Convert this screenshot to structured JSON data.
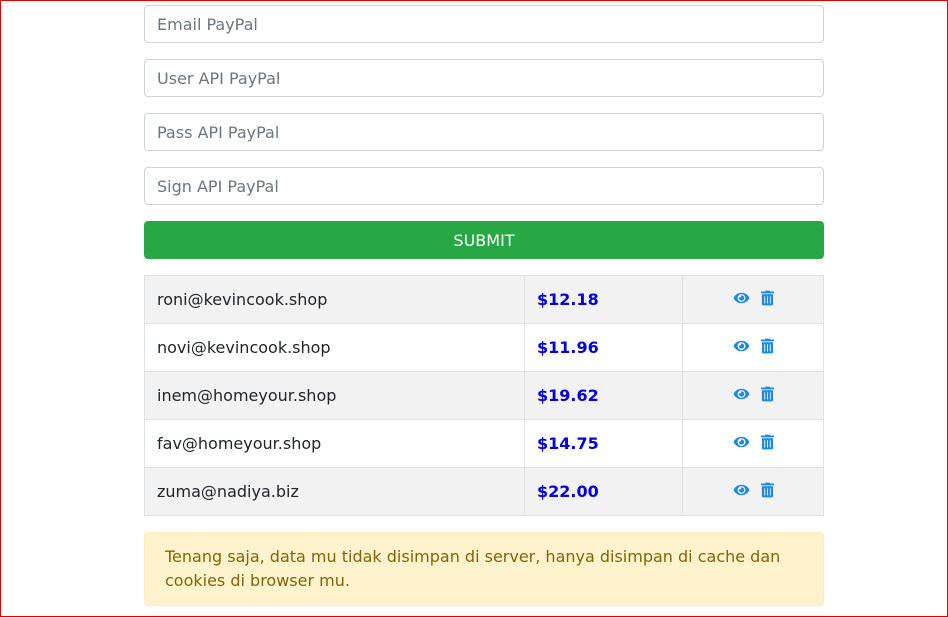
{
  "form": {
    "email_placeholder": "Email PayPal",
    "user_api_placeholder": "User API PayPal",
    "pass_api_placeholder": "Pass API PayPal",
    "sign_api_placeholder": "Sign API PayPal",
    "submit_label": "SUBMIT"
  },
  "accounts": [
    {
      "email": "roni@kevincook.shop",
      "amount": "$12.18"
    },
    {
      "email": "novi@kevincook.shop",
      "amount": "$11.96"
    },
    {
      "email": "inem@homeyour.shop",
      "amount": "$19.62"
    },
    {
      "email": "fav@homeyour.shop",
      "amount": "$14.75"
    },
    {
      "email": "zuma@nadiya.biz",
      "amount": "$22.00"
    }
  ],
  "icons": {
    "view": "eye-icon",
    "delete": "trash-icon"
  },
  "notice": {
    "text": "Tenang saja, data mu tidak disimpan di server, hanya disimpan di cache dan cookies di browser mu."
  },
  "colors": {
    "submit": "#28a745",
    "amount": "#0000e0",
    "icon": "#1e88e5",
    "notice_bg": "#fff3cd",
    "notice_text": "#856404",
    "frame": "#e00000"
  }
}
